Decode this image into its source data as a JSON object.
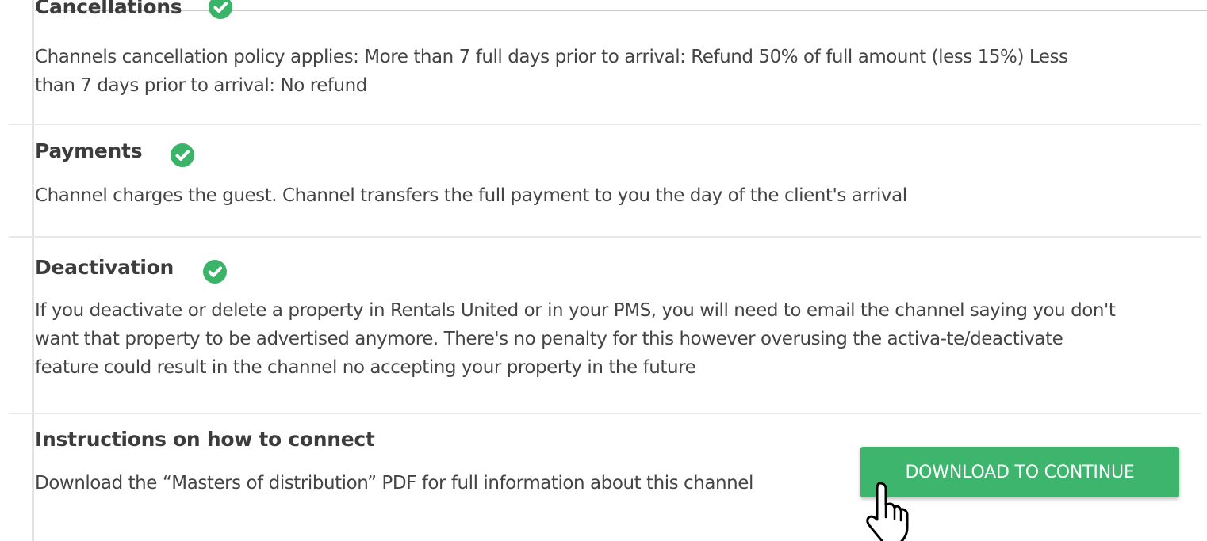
{
  "sections": [
    {
      "title": "Cancellations",
      "status_icon": "check-circle-icon",
      "text": "Channels cancellation policy applies: More than 7 full days prior to arrival: Refund 50% of full amount (less 15%) Less than 7 days prior to arrival: No refund"
    },
    {
      "title": "Payments",
      "status_icon": "check-circle-icon",
      "text": "Channel charges the guest. Channel transfers the full payment to you the day of the client's arrival"
    },
    {
      "title": "Deactivation",
      "status_icon": "check-circle-icon",
      "text": "If you deactivate or delete a property in Rentals United or in your PMS, you will need to email the channel saying you don't want that property to be advertised anymore. There's no penalty for this however overusing the activa-te/deactivate feature could result in the channel no accepting your property in the future"
    },
    {
      "title": "Instructions on how to connect",
      "text": "Download the “Masters of distribution” PDF for full information about this channel"
    }
  ],
  "actions": {
    "download_label": "DOWNLOAD TO CONTINUE"
  },
  "colors": {
    "accent_green": "#3eb56c",
    "text": "#444444",
    "heading": "#3c3c3c"
  },
  "cursor": "hand-pointer-icon"
}
